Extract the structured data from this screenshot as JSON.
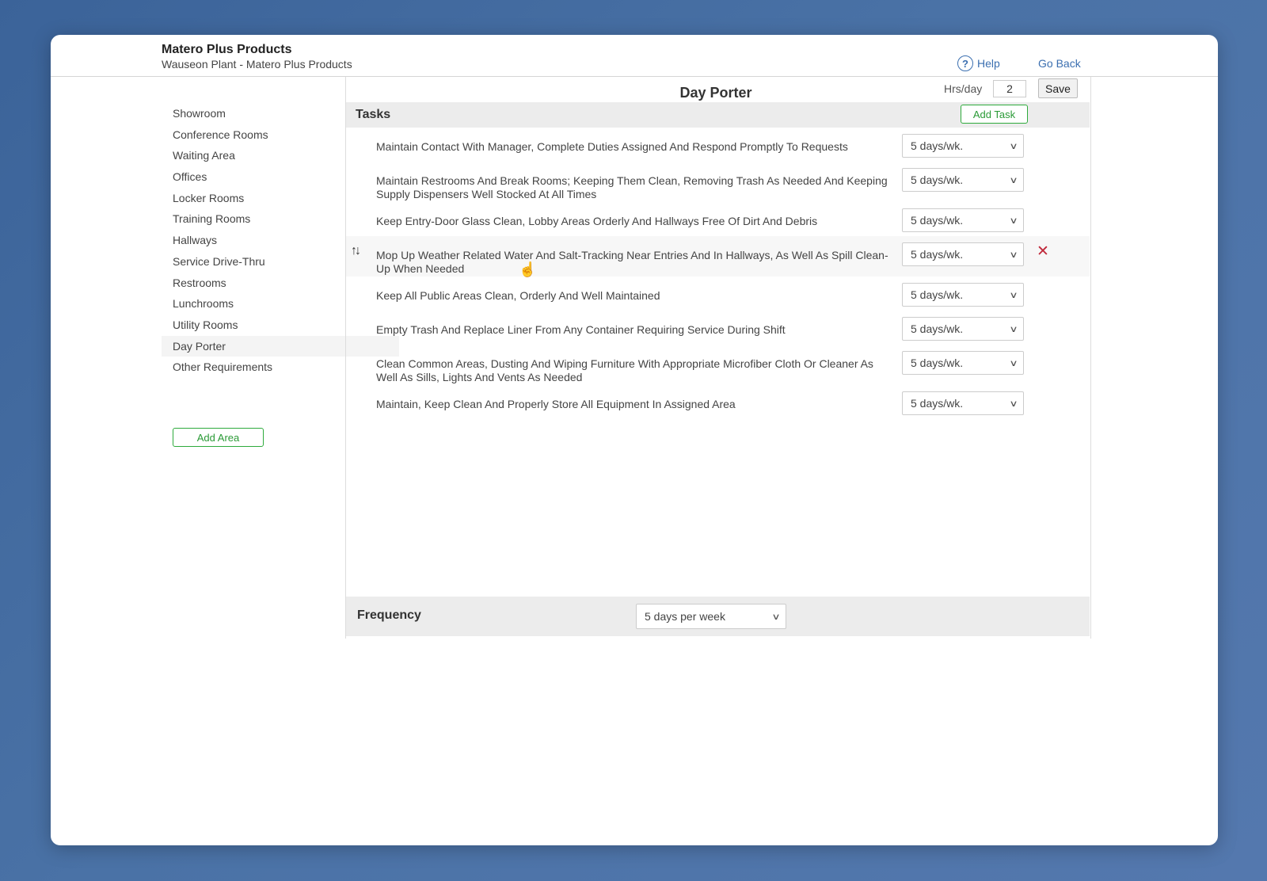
{
  "header": {
    "company_title": "Matero Plus Products",
    "company_subtitle": "Wauseon Plant - Matero Plus Products",
    "help_label": "Help",
    "go_back_label": "Go Back"
  },
  "sidebar": {
    "items": [
      {
        "label": "Showroom",
        "active": false
      },
      {
        "label": "Conference Rooms",
        "active": false
      },
      {
        "label": "Waiting Area",
        "active": false
      },
      {
        "label": "Offices",
        "active": false
      },
      {
        "label": "Locker Rooms",
        "active": false
      },
      {
        "label": "Training Rooms",
        "active": false
      },
      {
        "label": "Hallways",
        "active": false
      },
      {
        "label": "Service Drive-Thru",
        "active": false
      },
      {
        "label": "Restrooms",
        "active": false
      },
      {
        "label": "Lunchrooms",
        "active": false
      },
      {
        "label": "Utility Rooms",
        "active": false
      },
      {
        "label": "Day Porter",
        "active": true
      },
      {
        "label": "Other Requirements",
        "active": false
      }
    ],
    "add_area_label": "Add Area"
  },
  "main": {
    "title": "Day Porter",
    "hrs_label": "Hrs/day",
    "hrs_value": "2",
    "save_label": "Save",
    "tasks_title": "Tasks",
    "add_task_label": "Add Task",
    "tasks": [
      {
        "text": "Maintain Contact With Manager, Complete Duties Assigned And Respond Promptly To Requests",
        "frequency": "5 days/wk."
      },
      {
        "text": "Maintain Restrooms And Break Rooms; Keeping Them Clean, Removing Trash As Needed And Keeping Supply Dispensers Well Stocked At All Times",
        "frequency": "5 days/wk."
      },
      {
        "text": "Keep Entry-Door Glass Clean, Lobby Areas Orderly And Hallways Free Of Dirt And Debris",
        "frequency": "5 days/wk."
      },
      {
        "text": "Mop Up Weather Related Water And Salt-Tracking Near Entries And In Hallways, As Well As Spill Clean-Up When Needed",
        "frequency": "5 days/wk.",
        "hovered": true
      },
      {
        "text": "Keep All Public Areas Clean, Orderly And Well Maintained",
        "frequency": "5 days/wk."
      },
      {
        "text": "Empty Trash And Replace Liner From Any Container Requiring Service During Shift",
        "frequency": "5 days/wk."
      },
      {
        "text": "Clean Common Areas, Dusting And Wiping Furniture With Appropriate Microfiber Cloth Or Cleaner As Well As Sills, Lights And Vents As Needed",
        "frequency": "5 days/wk."
      },
      {
        "text": "Maintain, Keep Clean And Properly Store All Equipment In Assigned Area",
        "frequency": "5 days/wk."
      }
    ],
    "frequency_label": "Frequency",
    "frequency_value": "5 days per week"
  },
  "icons": {
    "help": "help-circle-icon",
    "sort": "sort-arrows-icon",
    "delete": "close-x-icon",
    "cursor": "hand-pointer-icon",
    "dropdown": "chevron-down-icon"
  },
  "colors": {
    "accent_green": "#2eaa3c",
    "link_blue": "#3b6fb0",
    "delete_red": "#c0283a",
    "background": "#4a72a6"
  }
}
